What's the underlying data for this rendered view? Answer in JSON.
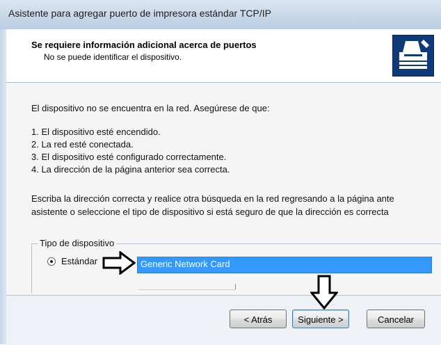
{
  "window": {
    "title": "Asistente para agregar puerto de impresora estándar TCP/IP"
  },
  "header": {
    "title": "Se requiere información adicional acerca de puertos",
    "subtitle": "No se puede identificar el dispositivo.",
    "icon": "printer-icon"
  },
  "content": {
    "intro": "El dispositivo no se encuentra en la red. Asegúrese de que:",
    "items": [
      "1. El dispositivo esté encendido.",
      "2. La red esté conectada.",
      "3. El dispositivo esté configurado correctamente.",
      "4. La dirección de la página anterior sea correcta."
    ],
    "paragraph_line1": "Escriba la dirección correcta y realice otra búsqueda en la red regresando a la página ante",
    "paragraph_line2": "asistente o seleccione el tipo de dispositivo si está seguro de que la dirección es correcta"
  },
  "device_type": {
    "group_label": "Tipo de dispositivo",
    "radio_label": "Estándar",
    "selected_value": "Generic Network Card"
  },
  "buttons": {
    "back": "< Atrás",
    "next": "Siguiente >",
    "cancel": "Cancelar"
  },
  "colors": {
    "selection": "#3399ff",
    "header_icon_bg": "#0f3a78"
  }
}
